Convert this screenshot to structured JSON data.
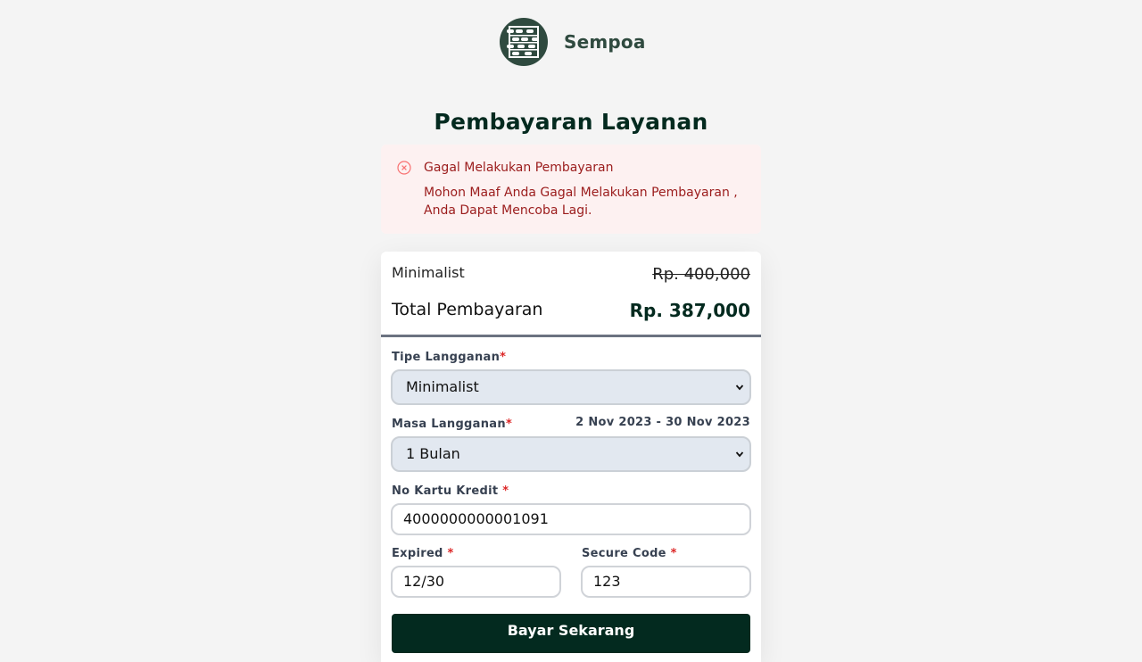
{
  "brand": {
    "name": "Sempoa"
  },
  "page": {
    "title": "Pembayaran Layanan"
  },
  "alert": {
    "title": "Gagal Melakukan Pembayaran",
    "message": "Mohon Maaf Anda Gagal Melakukan Pembayaran , Anda Dapat Mencoba Lagi.",
    "color": "#9b1c1c"
  },
  "summary": {
    "plan_name": "Minimalist",
    "original_price": "Rp. 400,000",
    "total_label": "Total Pembayaran",
    "total_value": "Rp. 387,000"
  },
  "form": {
    "subscription_type": {
      "label": "Tipe Langganan",
      "required_mark": "*",
      "value": "Minimalist"
    },
    "subscription_period": {
      "label": "Masa Langganan",
      "required_mark": "*",
      "value": "1 Bulan",
      "date_range": "2 Nov 2023 - 30 Nov 2023"
    },
    "card_number": {
      "label": "No Kartu Kredit",
      "required_mark": "*",
      "value": "4000000000001091"
    },
    "expired": {
      "label": "Expired",
      "required_mark": "*",
      "value": "12/30"
    },
    "secure_code": {
      "label": "Secure Code",
      "required_mark": "*",
      "value": "123"
    },
    "submit_label": "Bayar Sekarang"
  },
  "colors": {
    "primary": "#032a1f",
    "brand": "#2f4a3f",
    "required": "#dc2626",
    "alert_bg": "#fdf1f1"
  }
}
